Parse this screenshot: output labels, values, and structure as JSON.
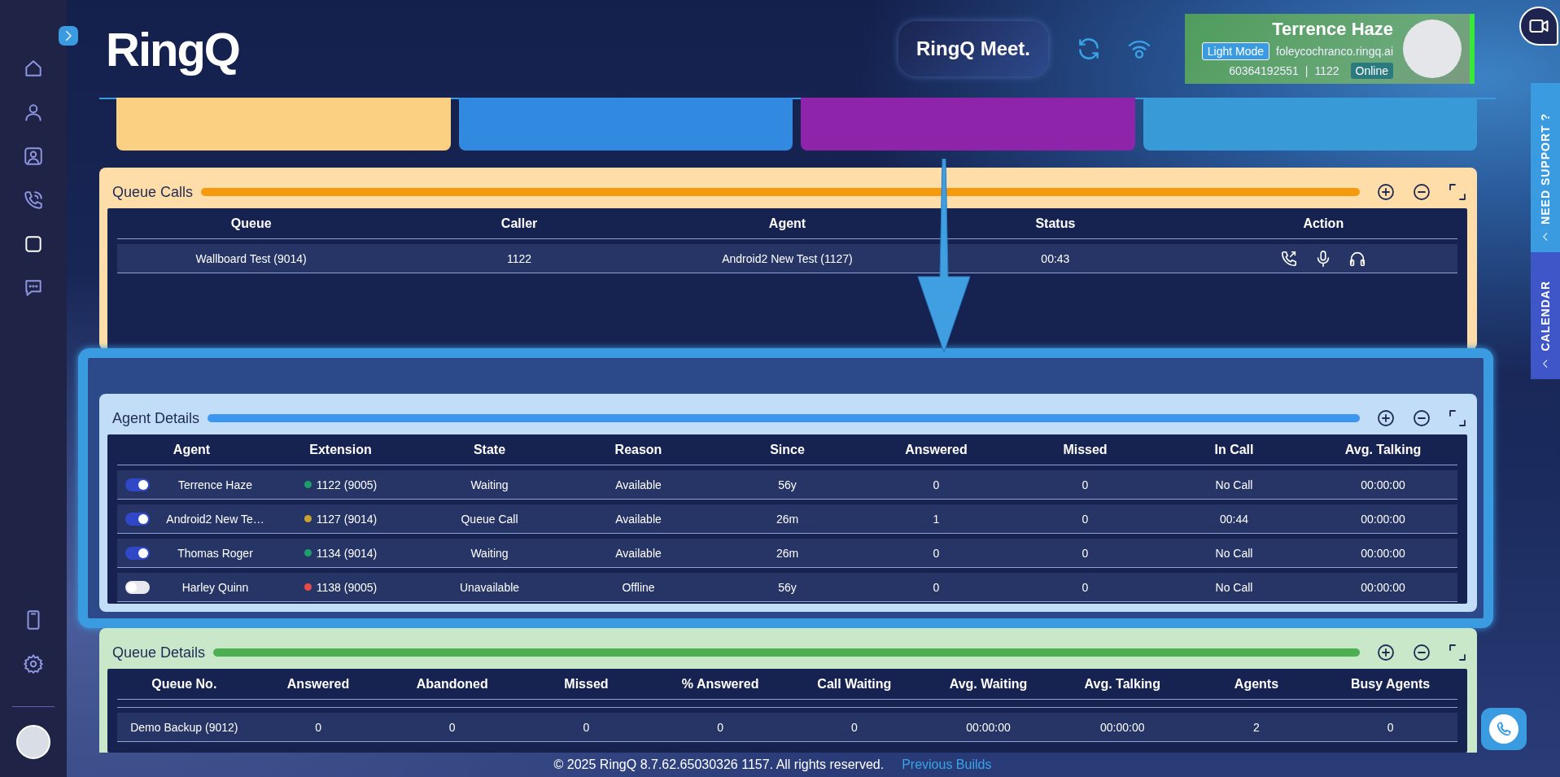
{
  "sidebar": {
    "items": [
      {
        "kind": "home",
        "selected": false
      },
      {
        "kind": "user",
        "selected": false
      },
      {
        "kind": "contact",
        "selected": false
      },
      {
        "kind": "phone",
        "selected": false
      },
      {
        "kind": "square",
        "selected": true
      },
      {
        "kind": "chat",
        "selected": false
      }
    ],
    "bottom_items": [
      {
        "kind": "device",
        "selected": false
      },
      {
        "kind": "gear",
        "selected": false
      }
    ]
  },
  "header": {
    "logo": "RingQ",
    "meet_button": "RingQ Meet.",
    "profile": {
      "name": "Terrence Haze",
      "mode_button": "Light Mode",
      "domain": "foleycochranco.ringq.ai",
      "phone": "60364192551",
      "separator": "|",
      "extension": "1122",
      "status": "Online"
    }
  },
  "stat_cards": [
    {
      "color": "#fcd083"
    },
    {
      "color": "#3189e0"
    },
    {
      "color": "#8e24aa"
    },
    {
      "color": "#389bd8"
    }
  ],
  "side_tabs": [
    {
      "label": "NEED SUPPORT ?"
    },
    {
      "label": "CALENDAR"
    }
  ],
  "queue_calls": {
    "title": "Queue Calls",
    "highlighted": false,
    "columns": [
      "Queue",
      "Caller",
      "Agent",
      "Status",
      "Action"
    ],
    "rows": [
      {
        "cells": [
          "Wallboard Test (9014)",
          "1122",
          "Android2 New Test (1127)",
          "00:43"
        ]
      }
    ]
  },
  "agent_details": {
    "title": "Agent Details",
    "highlighted": true,
    "columns": [
      "Agent",
      "Extension",
      "State",
      "Reason",
      "Since",
      "Answered",
      "Missed",
      "In Call",
      "Avg. Talking"
    ],
    "rows": [
      {
        "enabled": true,
        "color": "#1e9e6a",
        "cells": [
          "Terrence Haze",
          "1122 (9005)",
          "Waiting",
          "Available",
          "56y",
          "0",
          "0",
          "No Call",
          "00:00:00"
        ]
      },
      {
        "enabled": true,
        "color": "#c9a233",
        "cells": [
          "Android2 New Te…",
          "1127 (9014)",
          "Queue Call",
          "Available",
          "26m",
          "1",
          "0",
          "00:44",
          "00:00:00"
        ]
      },
      {
        "enabled": true,
        "color": "#1e9e6a",
        "cells": [
          "Thomas Roger",
          "1134 (9014)",
          "Waiting",
          "Available",
          "26m",
          "0",
          "0",
          "No Call",
          "00:00:00"
        ]
      },
      {
        "enabled": false,
        "color": "#e84a4a",
        "cells": [
          "Harley Quinn",
          "1138 (9005)",
          "Unavailable",
          "Offline",
          "56y",
          "0",
          "0",
          "No Call",
          "00:00:00"
        ]
      }
    ]
  },
  "queue_details": {
    "title": "Queue Details",
    "highlighted": false,
    "columns": [
      "Queue No.",
      "Answered",
      "Abandoned",
      "Missed",
      "% Answered",
      "Call Waiting",
      "Avg. Waiting",
      "Avg. Talking",
      "Agents",
      "Busy Agents"
    ],
    "rows": [
      {
        "cells": [
          "Demo Backup (9012)",
          "0",
          "0",
          "0",
          "0",
          "0",
          "00:00:00",
          "00:00:00",
          "2",
          "0"
        ]
      }
    ]
  },
  "footer": {
    "copyright": "© 2025 RingQ 8.7.62.65030326 1157. All rights reserved.",
    "link": "Previous Builds"
  }
}
